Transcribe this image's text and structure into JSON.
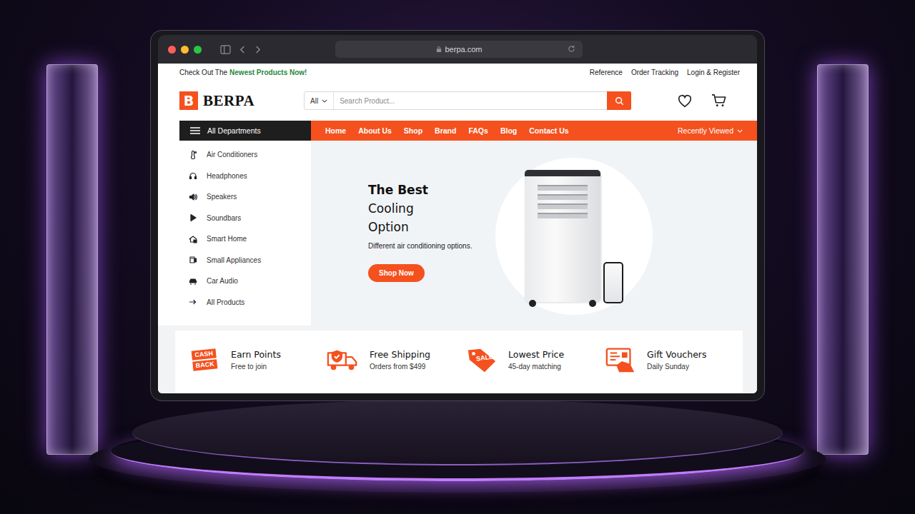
{
  "browser": {
    "url": "berpa.com"
  },
  "topbar": {
    "promo": "Check Out The",
    "promo_highlight": "Newest Products Now!",
    "links": [
      "Reference",
      "Order Tracking",
      "Login & Register"
    ]
  },
  "logo": {
    "letter": "B",
    "name": "BERPA"
  },
  "search": {
    "category": "All",
    "placeholder": "Search Product..."
  },
  "nav": {
    "departments": "All Departments",
    "links": [
      "Home",
      "About Us",
      "Shop",
      "Brand",
      "FAQs",
      "Blog",
      "Contact Us"
    ],
    "recent": "Recently Viewed"
  },
  "departments": [
    "Air Conditioners",
    "Headphones",
    "Speakers",
    "Soundbars",
    "Smart Home",
    "Small Appliances",
    "Car Audio",
    "All Products"
  ],
  "hero": {
    "title": "The Best",
    "lines": [
      "Cooling",
      "Option"
    ],
    "text": "Different air conditioning options.",
    "button": "Shop Now"
  },
  "features": [
    {
      "title": "Earn Points",
      "text": "Free to join",
      "icon_text": [
        "CASH",
        "BACK"
      ]
    },
    {
      "title": "Free Shipping",
      "text": "Orders from $499",
      "icon_text": []
    },
    {
      "title": "Lowest Price",
      "text": "45-day matching",
      "icon_text": [
        "SALE"
      ]
    },
    {
      "title": "Gift Vouchers",
      "text": "Daily Sunday",
      "icon_text": []
    }
  ]
}
